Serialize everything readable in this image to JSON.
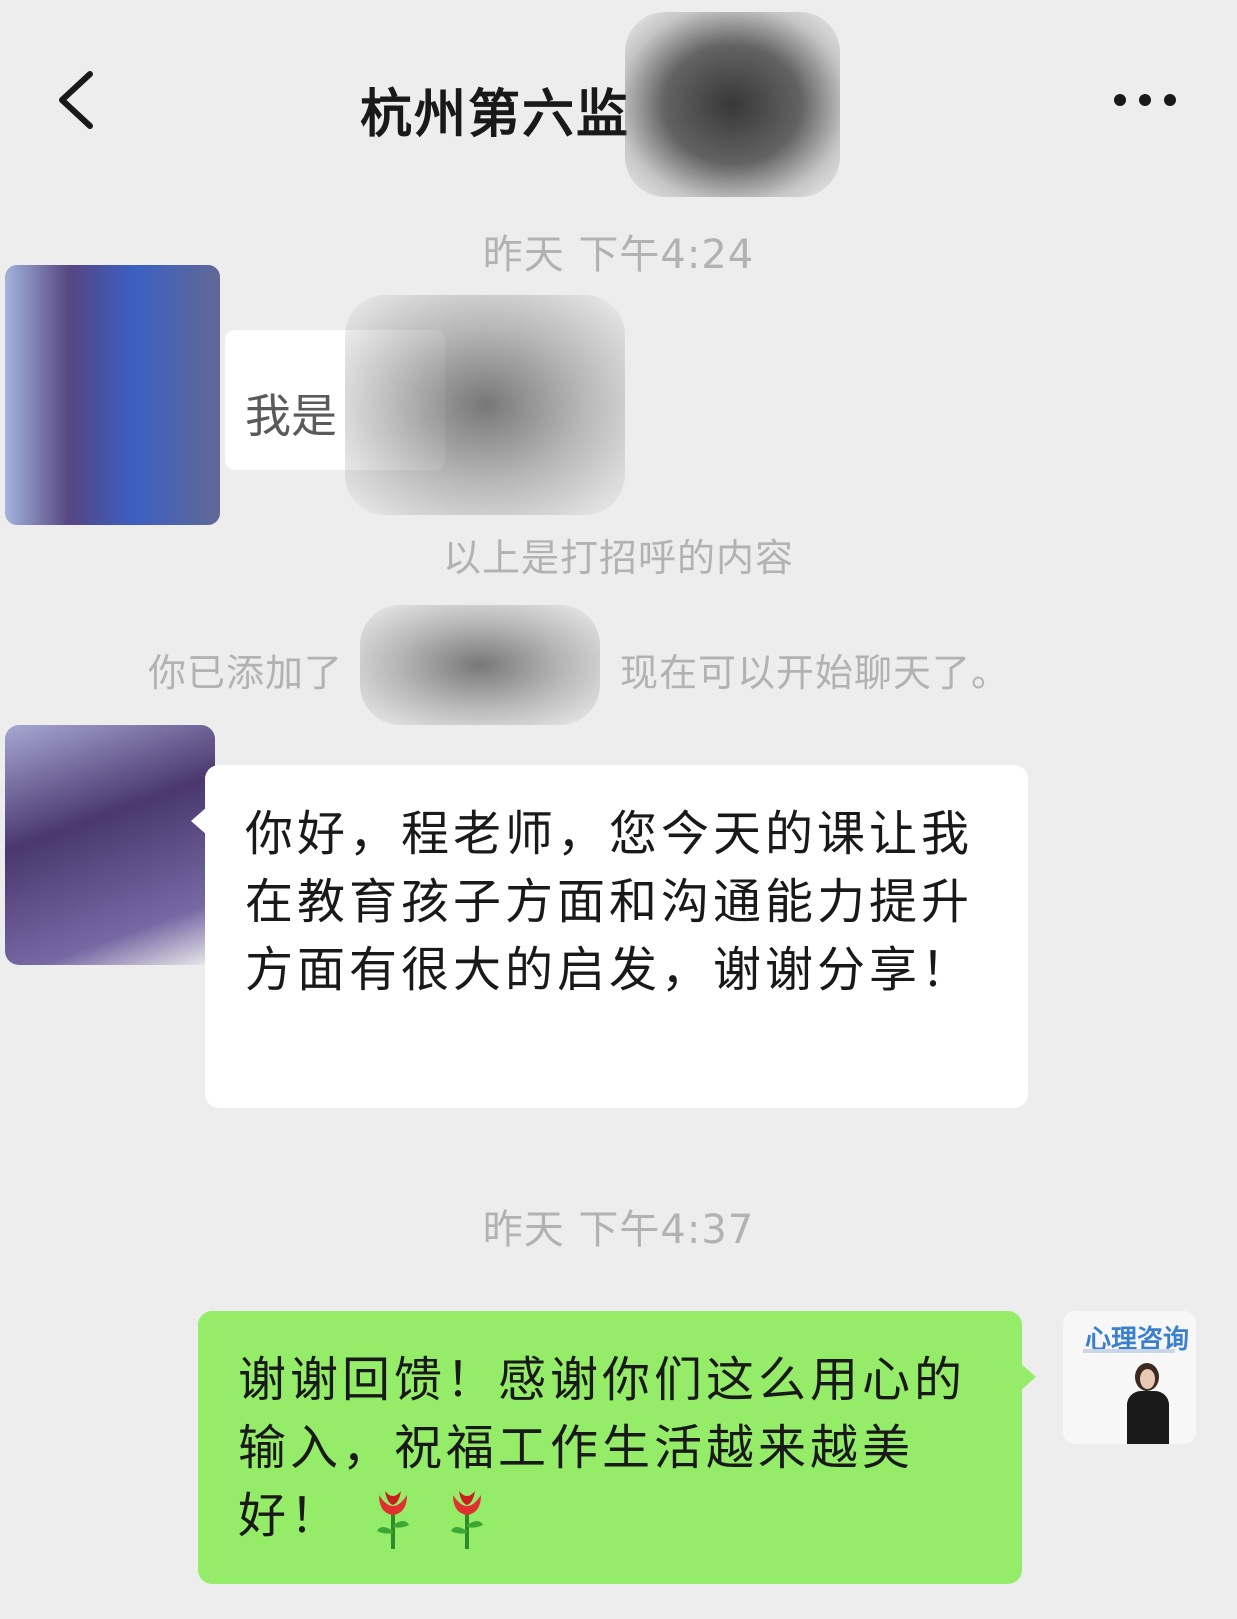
{
  "nav": {
    "title": "杭州第六监",
    "back_icon": "chevron-left-icon",
    "more_icon": "more-dots-icon"
  },
  "messages": {
    "time_1": "昨天 下午4:24",
    "greeting_visible_text": "我是",
    "greeting_notice": "以上是打招呼的内容",
    "added_prefix": "你已添加了",
    "added_suffix": "现在可以开始聊天了。",
    "incoming_text": "你好，程老师，您今天的课让我在教育孩子方面和沟通能力提升方面有很大的启发，谢谢分享！",
    "time_2": "昨天 下午4:37",
    "outgoing_text": "谢谢回馈！感谢你们这么用心的输入，祝福工作生活越来越美好！",
    "outgoing_emoji": "rose-icon rose-icon"
  },
  "my_avatar": {
    "title": "心理咨询"
  },
  "colors": {
    "background": "#ededed",
    "incoming_bubble": "#ffffff",
    "outgoing_bubble": "#95ec69",
    "timestamp": "#b2b2b2"
  }
}
